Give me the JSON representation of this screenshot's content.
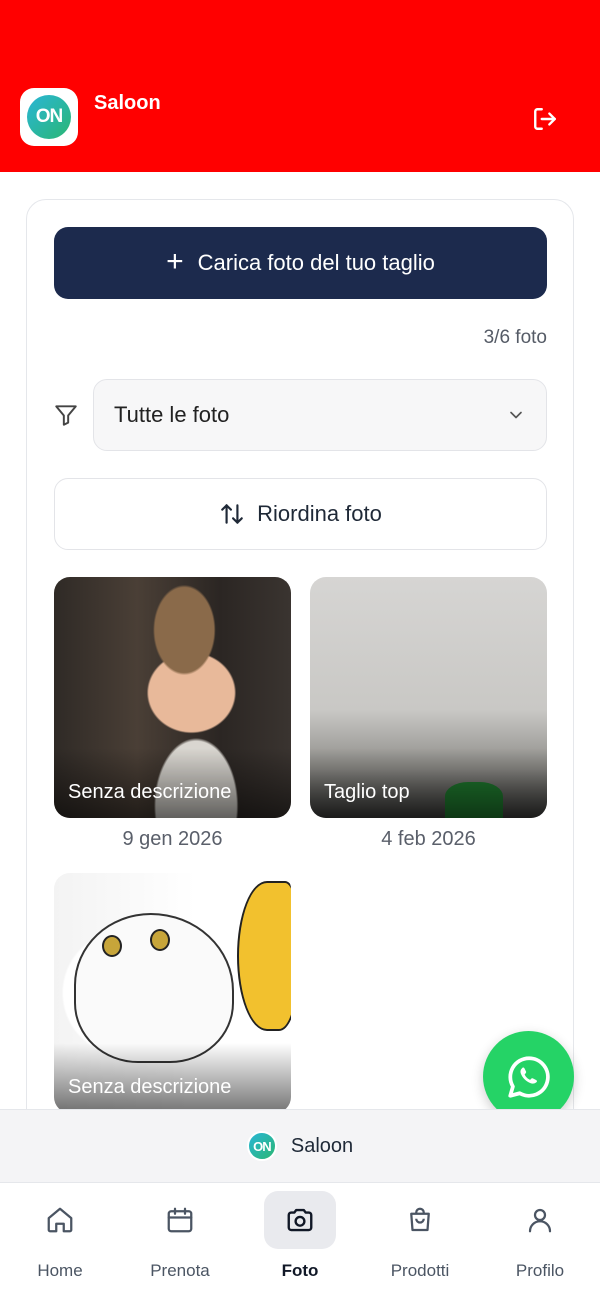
{
  "header": {
    "title": "Saloon",
    "logo_text": "ON",
    "background": "#ff0000",
    "logout_icon": "logout-icon"
  },
  "main": {
    "upload_label": "Carica foto del tuo taglio",
    "counter": "3/6 foto",
    "filter": {
      "selected": "Tutte le foto",
      "icon": "filter-icon"
    },
    "reorder_label": "Riordina foto",
    "photos": [
      {
        "caption": "Senza descrizione",
        "date": "9 gen 2026"
      },
      {
        "caption": "Taglio top",
        "date": "4 feb 2026"
      },
      {
        "caption": "Senza descrizione",
        "date": ""
      }
    ]
  },
  "brand_strip": {
    "logo_text": "ON",
    "name": "Saloon"
  },
  "bottom_nav": {
    "items": [
      {
        "label": "Home",
        "icon": "home-icon"
      },
      {
        "label": "Prenota",
        "icon": "calendar-icon"
      },
      {
        "label": "Foto",
        "icon": "camera-icon",
        "active": true
      },
      {
        "label": "Prodotti",
        "icon": "shopping-bag-icon"
      },
      {
        "label": "Profilo",
        "icon": "user-icon"
      }
    ]
  },
  "colors": {
    "primary": "#1c2a4d",
    "whatsapp": "#25d366",
    "header": "#ff0000"
  }
}
